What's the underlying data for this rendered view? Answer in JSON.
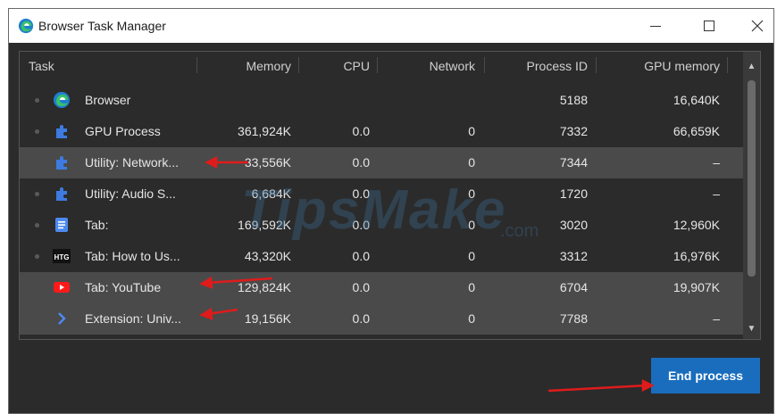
{
  "window": {
    "title": "Browser Task Manager",
    "accent": "#1a6dbd"
  },
  "columns": [
    "Task",
    "Memory",
    "CPU",
    "Network",
    "Process ID",
    "GPU memory"
  ],
  "rows": [
    {
      "icon": "edge-icon",
      "task": "Browser",
      "memory": "",
      "cpu": "",
      "network": "",
      "pid": "5188",
      "gpu": "16,640K",
      "selected": false,
      "dot": true
    },
    {
      "icon": "puzzle-icon",
      "task": "GPU Process",
      "memory": "361,924K",
      "cpu": "0.0",
      "network": "0",
      "pid": "7332",
      "gpu": "66,659K",
      "selected": false,
      "dot": true
    },
    {
      "icon": "puzzle-icon",
      "task": "Utility: Network...",
      "memory": "33,556K",
      "cpu": "0.0",
      "network": "0",
      "pid": "7344",
      "gpu": "–",
      "selected": true,
      "dot": false
    },
    {
      "icon": "puzzle-icon",
      "task": "Utility: Audio S...",
      "memory": "6,684K",
      "cpu": "0.0",
      "network": "0",
      "pid": "1720",
      "gpu": "–",
      "selected": false,
      "dot": true
    },
    {
      "icon": "document-icon",
      "task": "Tab:",
      "memory": "169,592K",
      "cpu": "0.0",
      "network": "0",
      "pid": "3020",
      "gpu": "12,960K",
      "selected": false,
      "dot": true
    },
    {
      "icon": "htg-icon",
      "task": "Tab: How to Us...",
      "memory": "43,320K",
      "cpu": "0.0",
      "network": "0",
      "pid": "3312",
      "gpu": "16,976K",
      "selected": false,
      "dot": true
    },
    {
      "icon": "youtube-icon",
      "task": "Tab: YouTube",
      "memory": "129,824K",
      "cpu": "0.0",
      "network": "0",
      "pid": "6704",
      "gpu": "19,907K",
      "selected": true,
      "dot": false
    },
    {
      "icon": "extension-chevron-icon",
      "task": "Extension: Univ...",
      "memory": "19,156K",
      "cpu": "0.0",
      "network": "0",
      "pid": "7788",
      "gpu": "–",
      "selected": true,
      "dot": false
    }
  ],
  "htg_label": "HTG",
  "end_button": "End process",
  "watermark": {
    "text": "TipsMake",
    "suffix": ".com"
  }
}
